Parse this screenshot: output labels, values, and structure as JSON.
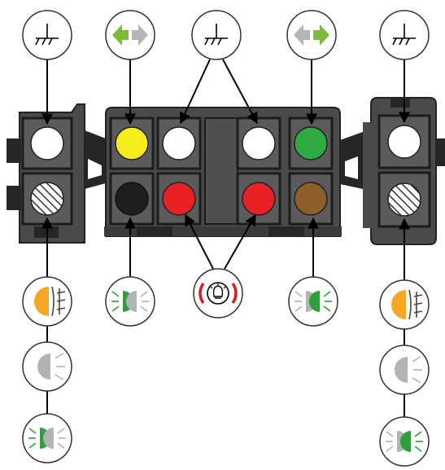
{
  "colors": {
    "connector_body": "#4a4a4c",
    "connector_dark": "#262626",
    "connector_mid": "#5b5b5d",
    "cell_outline": "#1c1c1c",
    "pin_white": "#ffffff",
    "pin_yellow": "#f6ec1a",
    "pin_green": "#2eab43",
    "pin_black": "#1e1e1e",
    "pin_red": "#e82127",
    "pin_brown": "#8b5e2a",
    "pin_hatched": "#ffffff",
    "arrow_green": "#7dbb3a",
    "arrow_grey": "#b5b5b5",
    "lamp_orange": "#f5a623",
    "lamp_grey": "#b3b3b3",
    "lamp_green": "#2e9f3c",
    "hazard_red": "#d71920",
    "line": "#000000"
  },
  "connector": {
    "left_block_pins": [
      {
        "id": "L1",
        "color": "white",
        "row": "top"
      },
      {
        "id": "L2",
        "color": "hatched",
        "row": "bottom"
      }
    ],
    "center_block_pins": [
      {
        "id": "C1",
        "color": "yellow",
        "row": "top"
      },
      {
        "id": "C2",
        "color": "white",
        "row": "top"
      },
      {
        "id": "C3",
        "color": "white",
        "row": "top"
      },
      {
        "id": "C4",
        "color": "green",
        "row": "top"
      },
      {
        "id": "C5",
        "color": "black",
        "row": "bottom"
      },
      {
        "id": "C6",
        "color": "red",
        "row": "bottom"
      },
      {
        "id": "C7",
        "color": "red",
        "row": "bottom"
      },
      {
        "id": "C8",
        "color": "brown",
        "row": "bottom"
      }
    ],
    "right_block_pins": [
      {
        "id": "R1",
        "color": "white",
        "row": "top"
      },
      {
        "id": "R2",
        "color": "hatched",
        "row": "bottom"
      }
    ]
  },
  "function_icons": {
    "top": [
      "ground-icon",
      "left-turn-signal-icon",
      "ground-icon",
      "right-turn-signal-icon",
      "ground-icon"
    ],
    "bottom_left_stack": [
      "rear-fog-lamp-icon",
      "position-lamp-icon",
      "side-marker-lamp-icon"
    ],
    "bottom_middle": [
      "side-marker-lamp-left-icon",
      "brake-warning-lamp-icon",
      "side-marker-lamp-right-icon"
    ],
    "bottom_right_stack": [
      "rear-fog-lamp-icon",
      "position-lamp-icon",
      "side-marker-lamp-icon"
    ]
  }
}
